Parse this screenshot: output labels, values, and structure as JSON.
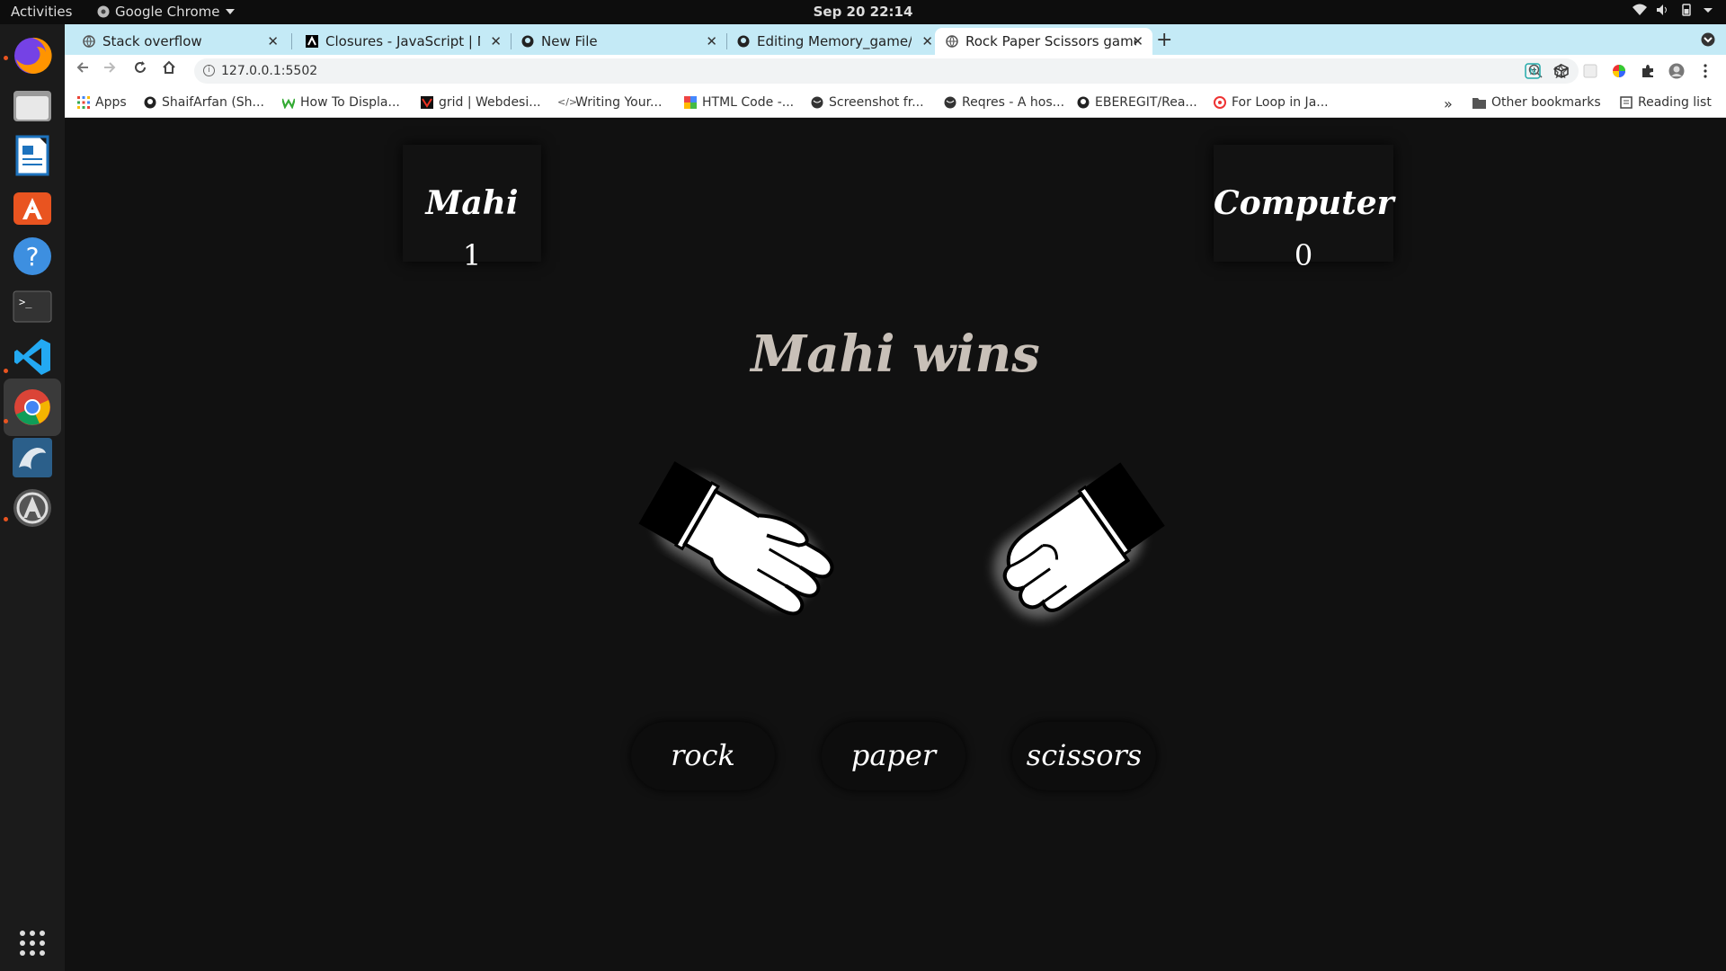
{
  "topbar": {
    "activities": "Activities",
    "app_name": "Google Chrome",
    "clock": "Sep 20  22:14"
  },
  "dock": {
    "items": [
      "firefox-icon",
      "files-icon",
      "writer-icon",
      "software-icon",
      "help-icon",
      "terminal-icon",
      "vscode-icon",
      "chrome-icon",
      "mysql-workbench-icon",
      "updater-icon",
      "show-apps-icon"
    ]
  },
  "browser": {
    "tabs": [
      {
        "title": "Stack overflow",
        "active": false
      },
      {
        "title": "Closures - JavaScript | MDN",
        "active": false
      },
      {
        "title": "New File",
        "active": false
      },
      {
        "title": "Editing Memory_game/README",
        "active": false
      },
      {
        "title": "Rock Paper Scissors game",
        "active": true
      }
    ],
    "url": "127.0.0.1:5502",
    "bookmarks": [
      "Apps",
      "ShaifArfan (Sh...",
      "How To Displa...",
      "grid | Webdesi...",
      "Writing Your...",
      "HTML Code -...",
      "Screenshot fr...",
      "Reqres - A hos...",
      "EBEREGIT/Rea...",
      "For Loop in Ja..."
    ],
    "other_bookmarks": "Other bookmarks",
    "reading_list": "Reading list",
    "overflow": "»"
  },
  "game": {
    "player": {
      "name": "Mahi",
      "score": "1"
    },
    "computer": {
      "name": "Computer",
      "score": "0"
    },
    "result": "Mahi wins",
    "player_hand": "paper",
    "computer_hand": "rock",
    "buttons": {
      "rock": "rock",
      "paper": "paper",
      "scissors": "scissors"
    }
  }
}
